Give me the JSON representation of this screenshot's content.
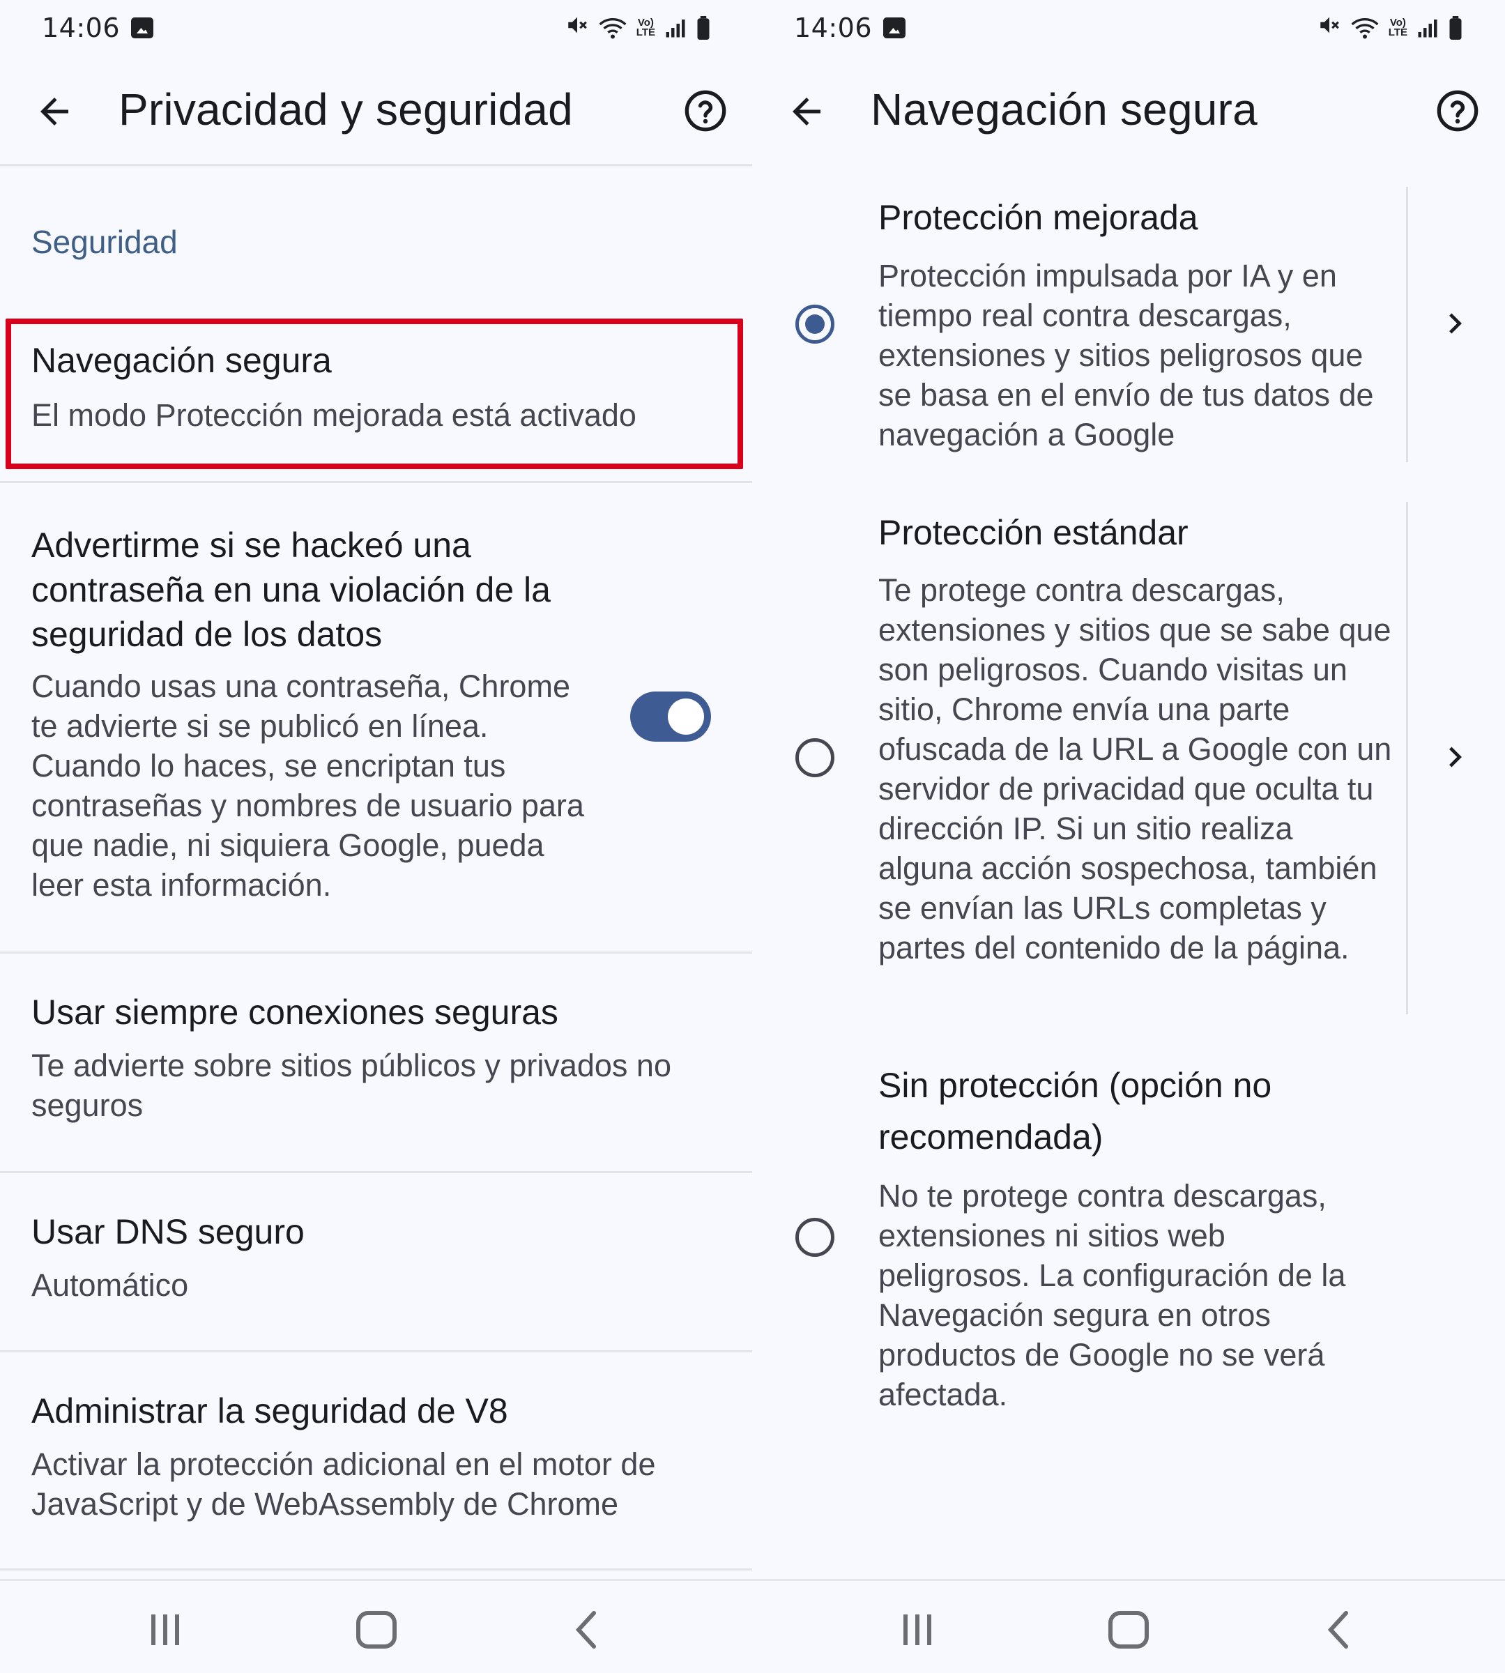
{
  "colors": {
    "accent": "#3f5b94",
    "highlight_border": "#d9001b",
    "section_header": "#3f5f86",
    "background": "#f8f9fe"
  },
  "left_screen": {
    "status_bar": {
      "time": "14:06"
    },
    "app_bar": {
      "back_icon": "arrow-left-icon",
      "title": "Privacidad y seguridad",
      "help_icon": "help-circle-icon"
    },
    "section_header": "Seguridad",
    "items": [
      {
        "title": "Navegación segura",
        "summary": "El modo Protección mejorada está activado"
      },
      {
        "title": "Advertirme si se hackeó una contraseña en una violación de la seguridad de los datos",
        "summary": "Cuando usas una contraseña, Chrome te advierte si se publicó en línea. Cuando lo haces, se encriptan tus contraseñas y nombres de usuario para que nadie, ni siquiera Google, pueda leer esta información.",
        "toggle_on": true
      },
      {
        "title": "Usar siempre conexiones seguras",
        "summary": "Te advierte sobre sitios públicos y privados no seguros"
      },
      {
        "title": "Usar DNS seguro",
        "summary": "Automático"
      },
      {
        "title": "Administrar la seguridad de V8",
        "summary": "Activar la protección adicional en el motor de JavaScript y de WebAssembly de Chrome"
      }
    ]
  },
  "right_screen": {
    "status_bar": {
      "time": "14:06"
    },
    "app_bar": {
      "back_icon": "arrow-left-icon",
      "title": "Navegación segura",
      "help_icon": "help-circle-icon"
    },
    "options": [
      {
        "title": "Protección mejorada",
        "description": "Protección impulsada por IA y en tiempo real contra descargas, extensiones y sitios peligrosos que se basa en el envío de tus datos de navegación a Google",
        "selected": true
      },
      {
        "title": "Protección estándar",
        "description": "Te protege contra descargas, extensiones y sitios que se sabe que son peligrosos. Cuando visitas un sitio, Chrome envía una parte ofuscada de la URL a Google con un servidor de privacidad que oculta tu dirección IP. Si un sitio realiza alguna acción sospechosa, también se envían las URLs completas y partes del contenido de la página.",
        "selected": false
      },
      {
        "title": "Sin protección (opción no recomendada)",
        "description": "No te protege contra descargas, extensiones ni sitios web peligrosos. La configuración de la Navegación segura en otros productos de Google no se verá afectada.",
        "selected": false
      }
    ]
  },
  "nav_bar": {
    "icons": [
      "recent-apps-icon",
      "home-icon",
      "back-icon"
    ]
  }
}
